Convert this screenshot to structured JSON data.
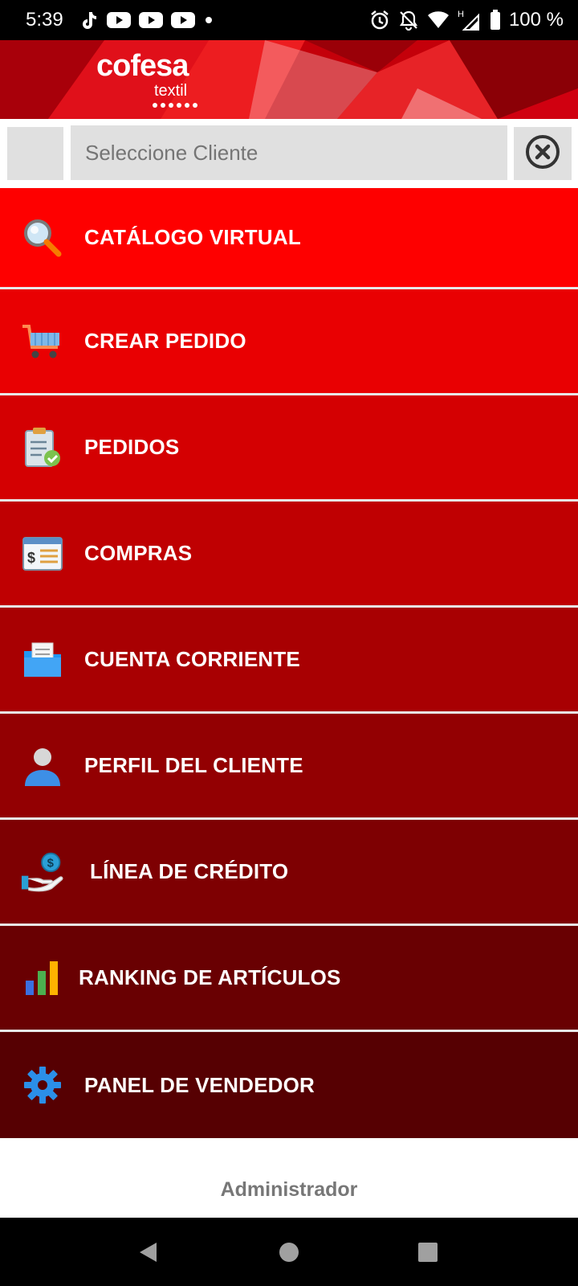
{
  "status_bar": {
    "time": "5:39",
    "battery_text": "100 %",
    "left_icons": [
      "tiktok-icon",
      "youtube-icon",
      "youtube-icon",
      "youtube-icon",
      "dot-icon"
    ],
    "right_icons": [
      "alarm-icon",
      "notifications-off-icon",
      "wifi-icon",
      "network-signal-icon",
      "battery-icon"
    ],
    "network_type": "H"
  },
  "banner": {
    "logo_main": "cofesa",
    "logo_sub": "textil",
    "colors": {
      "primary": "#c4000a",
      "accent": "#ff2a2a"
    }
  },
  "client_selector": {
    "placeholder": "Seleccione Cliente",
    "clear_icon": "clear-circle-icon"
  },
  "menu": {
    "items": [
      {
        "label": "CATÁLOGO VIRTUAL",
        "icon": "search-icon",
        "color": "#fe0000"
      },
      {
        "label": "CREAR PEDIDO",
        "icon": "shopping-cart-icon",
        "color": "#e90002"
      },
      {
        "label": "PEDIDOS",
        "icon": "clipboard-check-icon",
        "color": "#d40002"
      },
      {
        "label": "COMPRAS",
        "icon": "receipt-icon",
        "color": "#bf0002"
      },
      {
        "label": "CUENTA CORRIENTE",
        "icon": "folder-document-icon",
        "color": "#a80002"
      },
      {
        "label": "PERFIL DEL CLIENTE",
        "icon": "user-profile-icon",
        "color": "#930002"
      },
      {
        "label": "LÍNEA DE CRÉDITO",
        "icon": "hand-money-icon",
        "color": "#7e0002"
      },
      {
        "label": "RANKING DE ARTÍCULOS",
        "icon": "bar-chart-icon",
        "color": "#690002"
      },
      {
        "label": "PANEL DE VENDEDOR",
        "icon": "gear-icon",
        "color": "#560002"
      }
    ]
  },
  "footer": {
    "text": "Administrador"
  },
  "nav_bar": {
    "buttons": [
      "back-icon",
      "home-icon",
      "recents-icon"
    ]
  }
}
